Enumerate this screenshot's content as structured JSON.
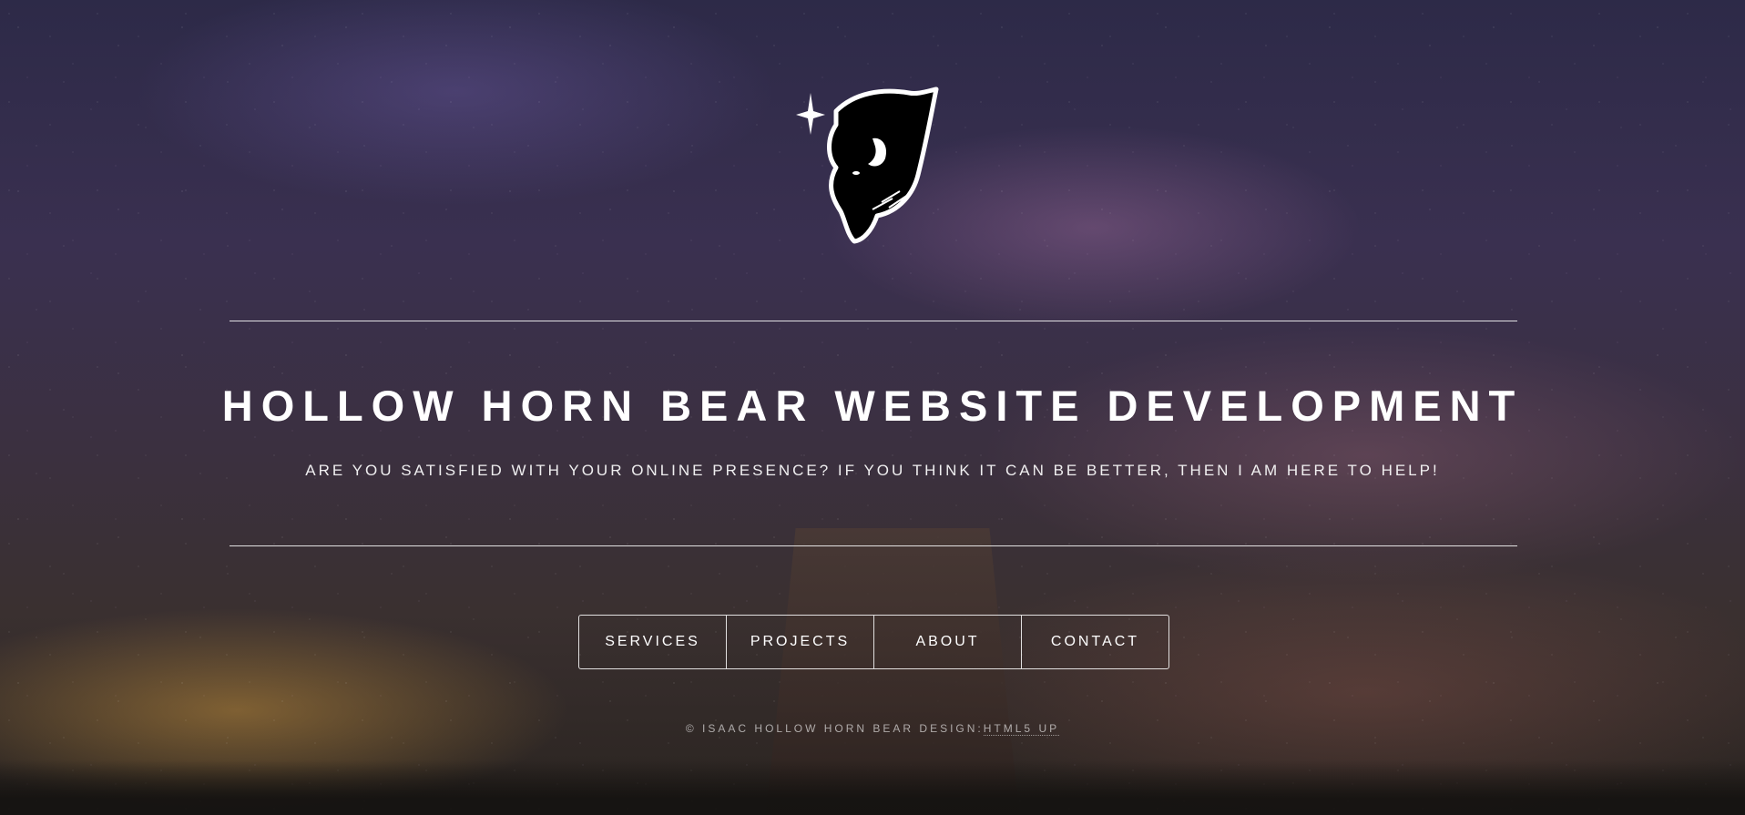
{
  "site": {
    "logo_icon": "bison-head-logo-icon",
    "title": "HOLLOW HORN BEAR WEBSITE DEVELOPMENT",
    "tagline": "ARE YOU SATISFIED WITH YOUR ONLINE PRESENCE? IF YOU THINK IT CAN BE BETTER, THEN I AM HERE TO HELP!"
  },
  "nav": {
    "items": [
      {
        "label": "SERVICES"
      },
      {
        "label": "PROJECTS"
      },
      {
        "label": "ABOUT"
      },
      {
        "label": "CONTACT"
      }
    ]
  },
  "footer": {
    "copyright": "© ISAAC HOLLOW HORN BEAR DESIGN:",
    "credit_link": "HTML5 UP"
  },
  "colors": {
    "text": "#ffffff",
    "rule": "#ffffff"
  }
}
